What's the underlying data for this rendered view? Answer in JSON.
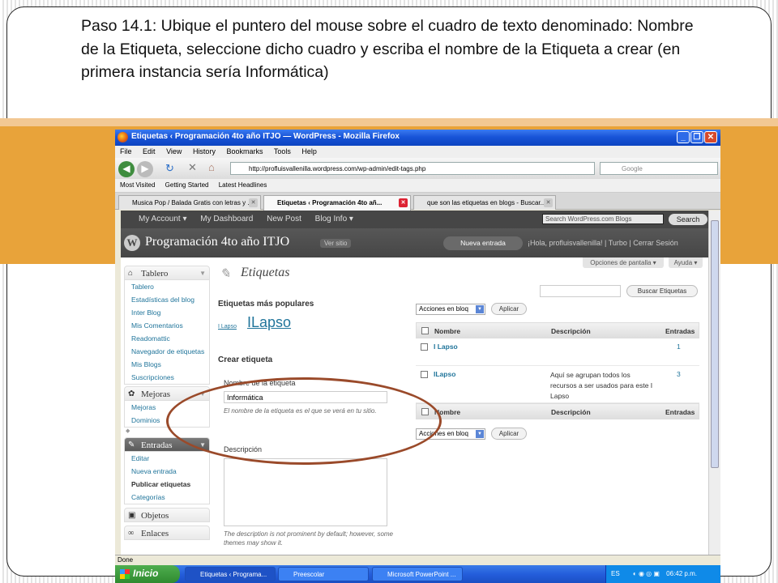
{
  "slide": {
    "instruction": "Paso 14.1: Ubique el puntero del mouse sobre el cuadro de texto denominado: Nombre de la Etiqueta, seleccione dicho cuadro y escriba el nombre de la Etiqueta a crear (en primera instancia sería Informática)"
  },
  "browser": {
    "window_title": "Etiquetas ‹ Programación 4to año ITJO — WordPress - Mozilla Firefox",
    "menu": [
      "File",
      "Edit",
      "View",
      "History",
      "Bookmarks",
      "Tools",
      "Help"
    ],
    "url": "http://profluisvallenilla.wordpress.com/wp-admin/edit-tags.php",
    "search_placeholder": "Google",
    "bookmarks": [
      "Most Visited",
      "Getting Started",
      "Latest Headlines"
    ],
    "tabs": [
      {
        "label": "Musica Pop / Balada Gratis con letras y ...",
        "active": false
      },
      {
        "label": "Etiquetas ‹ Programación 4to añ...",
        "active": true
      },
      {
        "label": "que son las etiquetas en blogs - Buscar...",
        "active": false
      }
    ],
    "status": "Done"
  },
  "wp_admin_bar": {
    "items": [
      "My Account ▾",
      "My Dashboard",
      "New Post",
      "Blog Info ▾"
    ],
    "search_placeholder": "Search WordPress.com Blogs",
    "search_button": "Search"
  },
  "wp_header": {
    "site_title": "Programación 4to año ITJO",
    "view_site": "Ver sitio",
    "new_entry": "Nueva entrada",
    "user_links": "¡Hola, profluisvallenilla! | Turbo | Cerrar Sesión"
  },
  "screen_options": "Opciones de pantalla ▾",
  "help": "Ayuda ▾",
  "sidebar": {
    "tablero": {
      "label": "Tablero",
      "items": [
        "Tablero",
        "Estadísticas del blog",
        "Inter Blog",
        "Mis Comentarios",
        "Readomattic",
        "Navegador de etiquetas",
        "Mis Blogs",
        "Suscripciones"
      ]
    },
    "mejoras": {
      "label": "Mejoras",
      "items": [
        "Mejoras",
        "Dominios"
      ]
    },
    "entradas": {
      "label": "Entradas",
      "items": [
        "Editar",
        "Nueva entrada",
        "Publicar etiquetas",
        "Categorías"
      ]
    },
    "objetos": {
      "label": "Objetos"
    },
    "enlaces": {
      "label": "Enlaces"
    }
  },
  "main": {
    "page_title": "Etiquetas",
    "popular_heading": "Etiquetas más populares",
    "popular_tags": [
      "I Lapso",
      "ILapso"
    ],
    "create_heading": "Crear etiqueta",
    "name_label": "Nombre de la etiqueta",
    "name_value": "Informática",
    "name_help": "El nombre de la etiqueta es el que se verá en tu sitio.",
    "description_label": "Descripción",
    "description_help": "The description is not prominent by default; however, some themes may show it.",
    "search_button": "Buscar Etiquetas",
    "bulk_action": "Acciones en bloq",
    "apply_button": "Aplicar",
    "table": {
      "headers": [
        "Nombre",
        "Descripción",
        "Entradas"
      ],
      "rows": [
        {
          "name": "I Lapso",
          "description": "",
          "count": "1"
        },
        {
          "name": "ILapso",
          "description": "Aquí se agrupan todos los recursos a ser usados para este I Lapso",
          "count": "3"
        }
      ]
    }
  },
  "taskbar": {
    "start": "Inicio",
    "tasks": [
      "Etiquetas ‹ Programa...",
      "Preescolar",
      "Microsoft PowerPoint ..."
    ],
    "lang": "ES",
    "time": "06:42 p.m."
  },
  "colors": {
    "band": "#E8A33A",
    "highlight_ellipse": "#9A4A2A",
    "link": "#21759B"
  }
}
